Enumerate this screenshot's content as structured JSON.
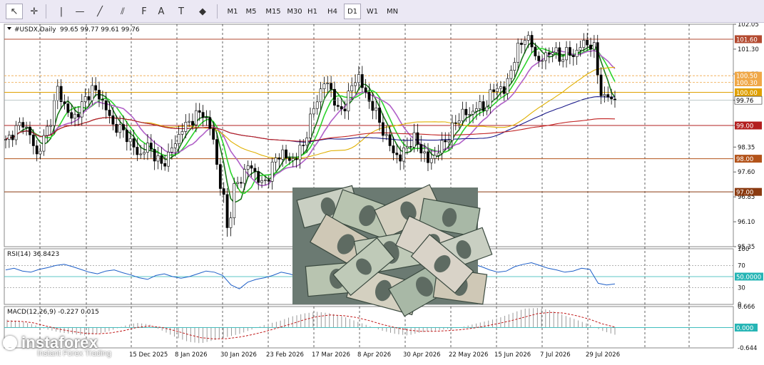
{
  "toolbar": {
    "tools": [
      {
        "name": "cursor-icon",
        "glyph": "↖",
        "active": true
      },
      {
        "name": "crosshair-icon",
        "glyph": "✛",
        "active": false
      },
      {
        "name": "vertical-line-icon",
        "glyph": "|",
        "active": false
      },
      {
        "name": "horizontal-line-icon",
        "glyph": "—",
        "active": false
      },
      {
        "name": "trendline-icon",
        "glyph": "╱",
        "active": false
      },
      {
        "name": "channel-icon",
        "glyph": "⫽",
        "active": false
      },
      {
        "name": "fibonacci-icon",
        "glyph": "F",
        "active": false
      },
      {
        "name": "text-icon",
        "glyph": "A",
        "active": false
      },
      {
        "name": "text-label-icon",
        "glyph": "T",
        "active": false
      },
      {
        "name": "shapes-icon",
        "glyph": "◆",
        "active": false
      }
    ],
    "timeframes": [
      "M1",
      "M5",
      "M15",
      "M30",
      "H1",
      "H4",
      "D1",
      "W1",
      "MN"
    ],
    "active_timeframe": "D1"
  },
  "chart_data": [
    {
      "type": "candlestick",
      "symbol_label": "#USDX,Daily",
      "ohlc_label": "99.65 99.77 99.61 99.76",
      "y_ticks": [
        "102.05",
        "101.30",
        "100.55",
        "99.76",
        "99.00",
        "98.35",
        "97.60",
        "96.85",
        "96.10",
        "95.35"
      ],
      "ylim": [
        95.35,
        102.05
      ],
      "last_price": "99.76",
      "x_tick_labels": [
        "15 Dec 2025",
        "8 Jan 2026",
        "30 Jan 2026",
        "23 Feb 2026",
        "17 Mar 2026",
        "8 Apr 2026",
        "30 Apr 2026",
        "22 May 2026",
        "15 Jun 2026",
        "7 Jul 2026",
        "29 Jul 2026"
      ],
      "close_path": [
        [
          0,
          98.5
        ],
        [
          3,
          98.9
        ],
        [
          5,
          99.1
        ],
        [
          7,
          98.7
        ],
        [
          9,
          98.1
        ],
        [
          11,
          98.6
        ],
        [
          13,
          99.2
        ],
        [
          15,
          100.1
        ],
        [
          17,
          99.6
        ],
        [
          19,
          99.2
        ],
        [
          21,
          99.4
        ],
        [
          23,
          99.8
        ],
        [
          25,
          100.1
        ],
        [
          27,
          99.9
        ],
        [
          29,
          99.5
        ],
        [
          31,
          99.0
        ],
        [
          33,
          98.9
        ],
        [
          35,
          98.7
        ],
        [
          37,
          98.3
        ],
        [
          39,
          98.1
        ],
        [
          41,
          98.4
        ],
        [
          43,
          98.1
        ],
        [
          45,
          97.8
        ],
        [
          47,
          98.1
        ],
        [
          49,
          98.5
        ],
        [
          51,
          98.9
        ],
        [
          53,
          99.1
        ],
        [
          55,
          99.3
        ],
        [
          57,
          99.4
        ],
        [
          59,
          98.9
        ],
        [
          60,
          98.6
        ],
        [
          61,
          97.8
        ],
        [
          62,
          97.2
        ],
        [
          63,
          96.8
        ],
        [
          64,
          95.9
        ],
        [
          65,
          96.4
        ],
        [
          66,
          97.1
        ],
        [
          68,
          97.4
        ],
        [
          70,
          97.8
        ],
        [
          72,
          97.6
        ],
        [
          74,
          97.2
        ],
        [
          76,
          97.5
        ],
        [
          78,
          98.0
        ],
        [
          80,
          98.2
        ],
        [
          82,
          97.9
        ],
        [
          84,
          98.1
        ],
        [
          86,
          98.4
        ],
        [
          88,
          99.2
        ],
        [
          90,
          99.8
        ],
        [
          92,
          100.3
        ],
        [
          94,
          100.1
        ],
        [
          96,
          99.4
        ],
        [
          98,
          99.6
        ],
        [
          100,
          100.2
        ],
        [
          102,
          100.5
        ],
        [
          104,
          99.9
        ],
        [
          106,
          99.6
        ],
        [
          108,
          99.1
        ],
        [
          110,
          98.6
        ],
        [
          112,
          98.2
        ],
        [
          114,
          98.0
        ],
        [
          116,
          98.4
        ],
        [
          118,
          98.6
        ],
        [
          120,
          98.3
        ],
        [
          122,
          97.9
        ],
        [
          124,
          98.1
        ],
        [
          126,
          98.4
        ],
        [
          128,
          98.7
        ],
        [
          130,
          99.1
        ],
        [
          132,
          99.4
        ],
        [
          134,
          99.3
        ],
        [
          136,
          99.6
        ],
        [
          138,
          99.5
        ],
        [
          140,
          99.9
        ],
        [
          142,
          100.2
        ],
        [
          144,
          100.0
        ],
        [
          146,
          100.7
        ],
        [
          148,
          101.3
        ],
        [
          150,
          101.7
        ],
        [
          152,
          101.4
        ],
        [
          154,
          100.9
        ],
        [
          156,
          101.1
        ],
        [
          158,
          101.3
        ],
        [
          160,
          101.0
        ],
        [
          162,
          101.2
        ],
        [
          164,
          101.1
        ],
        [
          166,
          101.4
        ],
        [
          168,
          101.5
        ],
        [
          170,
          101.3
        ],
        [
          171,
          100.6
        ],
        [
          172,
          100.0
        ],
        [
          173,
          99.8
        ],
        [
          174,
          99.9
        ],
        [
          175,
          99.8
        ],
        [
          176,
          99.76
        ]
      ],
      "horizontal_levels": [
        {
          "value": "101.60",
          "color": "#b34a30",
          "style": "solid"
        },
        {
          "value": "100.50",
          "color": "#f0a848",
          "style": "dashed"
        },
        {
          "value": "100.30",
          "color": "#f0a848",
          "style": "dashed"
        },
        {
          "value": "100.00",
          "color": "#e0a000",
          "style": "solid"
        },
        {
          "value": "99.00",
          "color": "#b32020",
          "style": "solid"
        },
        {
          "value": "98.00",
          "color": "#b3531a",
          "style": "solid"
        },
        {
          "value": "97.00",
          "color": "#8a3a10",
          "style": "solid"
        }
      ],
      "moving_averages": [
        {
          "color": "#1a7a1a"
        },
        {
          "color": "#2cd42c"
        },
        {
          "color": "#b060c8"
        },
        {
          "color": "#e0b000"
        },
        {
          "color": "#1a1a8a"
        },
        {
          "color": "#c02020"
        }
      ]
    },
    {
      "type": "line",
      "label": "RSI(14) 36.8423",
      "y_ticks": [
        "100",
        "70",
        "50.0000",
        "30",
        "0"
      ],
      "ylim": [
        0,
        100
      ],
      "levels": [
        70,
        50,
        30
      ],
      "highlight_level": "50.0000",
      "values": [
        62,
        65,
        60,
        58,
        63,
        66,
        70,
        72,
        68,
        63,
        58,
        55,
        60,
        62,
        57,
        53,
        48,
        45,
        52,
        55,
        50,
        47,
        50,
        55,
        60,
        58,
        52,
        35,
        28,
        40,
        45,
        48,
        52,
        58,
        55,
        50,
        53,
        60,
        65,
        70,
        68,
        62,
        58,
        55,
        50,
        47,
        45,
        48,
        55,
        60,
        62,
        58,
        55,
        60,
        66,
        70,
        72,
        68,
        62,
        58,
        60,
        68,
        72,
        75,
        70,
        65,
        62,
        58,
        60,
        65,
        63,
        38,
        35,
        36.8
      ]
    },
    {
      "type": "histogram",
      "label": "MACD(12,26,9) -0.227 0.015",
      "y_ticks": [
        "0.666",
        "0.000",
        "-0.644"
      ],
      "ylim": [
        -0.644,
        0.666
      ],
      "highlight_level": "0.000",
      "macd": [
        0.25,
        0.2,
        0.1,
        -0.05,
        -0.15,
        -0.2,
        -0.25,
        -0.2,
        -0.1,
        0.05,
        0.15,
        0.1,
        -0.1,
        -0.3,
        -0.45,
        -0.5,
        -0.4,
        -0.3,
        -0.2,
        -0.05,
        0.1,
        0.2,
        0.35,
        0.45,
        0.5,
        0.45,
        0.35,
        0.2,
        0.05,
        -0.1,
        -0.2,
        -0.25,
        -0.15,
        -0.1,
        -0.05,
        0.0,
        0.1,
        0.2,
        0.3,
        0.45,
        0.6,
        0.62,
        0.55,
        0.4,
        0.25,
        0.1,
        -0.1,
        -0.227
      ],
      "signal": [
        0.2,
        0.2,
        0.15,
        0.05,
        -0.05,
        -0.12,
        -0.18,
        -0.2,
        -0.17,
        -0.1,
        0.0,
        0.05,
        0.0,
        -0.1,
        -0.22,
        -0.32,
        -0.36,
        -0.35,
        -0.3,
        -0.22,
        -0.12,
        0.0,
        0.12,
        0.25,
        0.35,
        0.4,
        0.38,
        0.32,
        0.22,
        0.1,
        0.0,
        -0.08,
        -0.12,
        -0.12,
        -0.1,
        -0.07,
        -0.02,
        0.05,
        0.13,
        0.22,
        0.33,
        0.44,
        0.48,
        0.46,
        0.38,
        0.27,
        0.12,
        0.015
      ]
    }
  ],
  "watermark": {
    "title": "instaforex",
    "subtitle": "Instant Forex Trading"
  }
}
